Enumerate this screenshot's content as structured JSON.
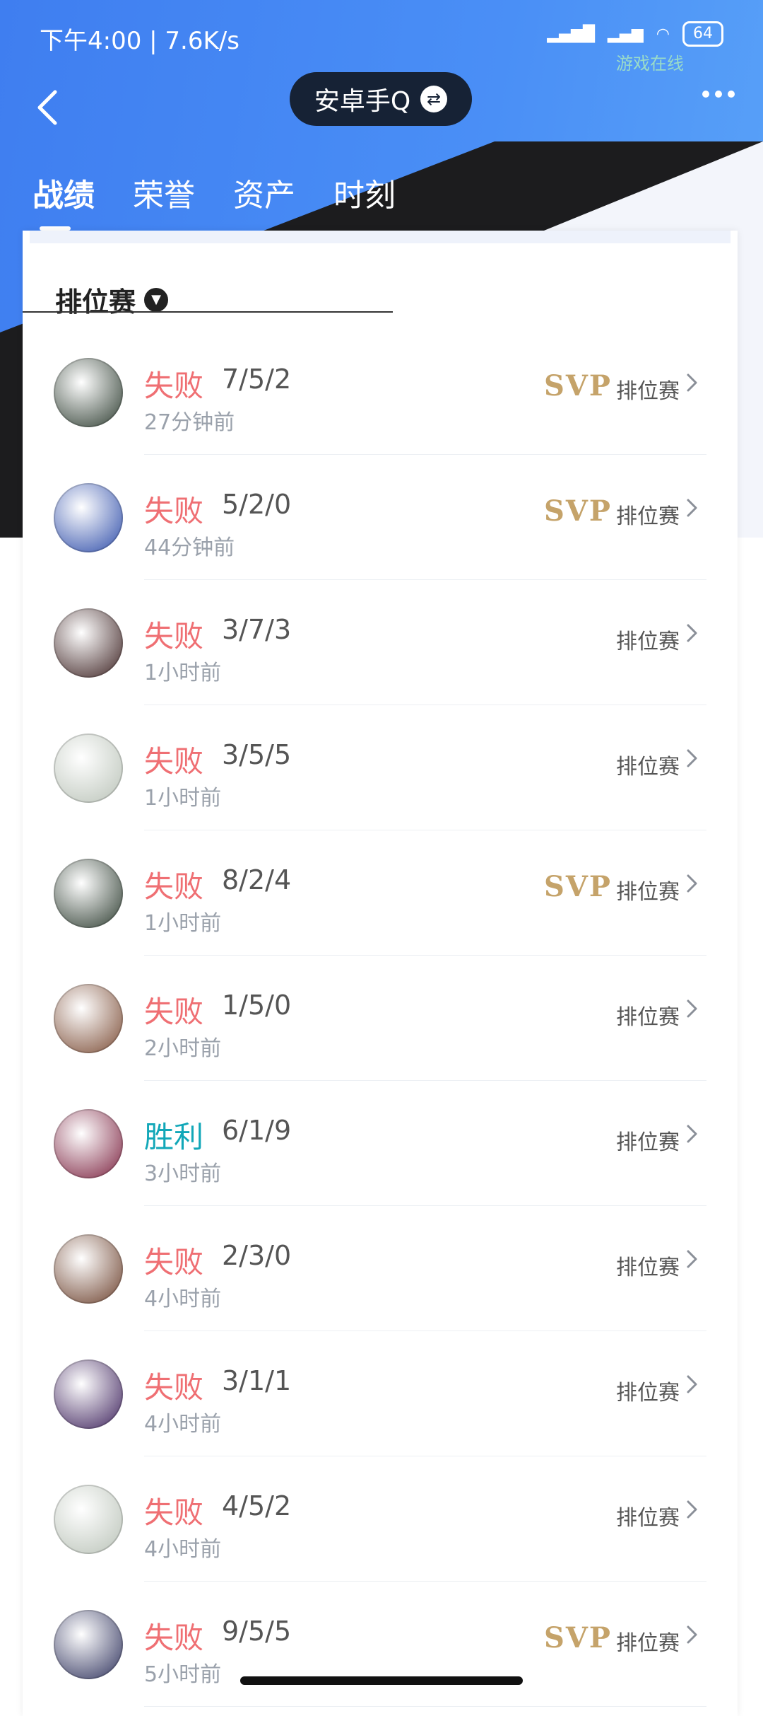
{
  "status_bar": {
    "time": "下午4:00 | 7.6K/s",
    "battery": "64",
    "game_online": "游戏在线"
  },
  "nav": {
    "account_name": "安卓手Q",
    "back_icon": "chevron-left-icon",
    "switch_icon": "switch-icon",
    "more_icon": "more-dots-icon"
  },
  "tabs": [
    "战绩",
    "荣誉",
    "资产",
    "时刻"
  ],
  "filter": {
    "label": "排位赛"
  },
  "matches": [
    {
      "result": "失败",
      "kda": "7/5/2",
      "time": "27分钟前",
      "svp": "SVP",
      "mode": "排位赛",
      "avatar_color": "#2b3a2e"
    },
    {
      "result": "失败",
      "kda": "5/2/0",
      "time": "44分钟前",
      "svp": "SVP",
      "mode": "排位赛",
      "avatar_color": "#2b4aa8"
    },
    {
      "result": "失败",
      "kda": "3/7/3",
      "time": "1小时前",
      "svp": "",
      "mode": "排位赛",
      "avatar_color": "#3a1f1f"
    },
    {
      "result": "失败",
      "kda": "3/5/5",
      "time": "1小时前",
      "svp": "",
      "mode": "排位赛",
      "avatar_color": "#b9c2b7"
    },
    {
      "result": "失败",
      "kda": "8/2/4",
      "time": "1小时前",
      "svp": "SVP",
      "mode": "排位赛",
      "avatar_color": "#2b3a2e"
    },
    {
      "result": "失败",
      "kda": "1/5/0",
      "time": "2小时前",
      "svp": "",
      "mode": "排位赛",
      "avatar_color": "#7a4a33"
    },
    {
      "result": "胜利",
      "kda": "6/1/9",
      "time": "3小时前",
      "svp": "",
      "mode": "排位赛",
      "avatar_color": "#7a1f3d"
    },
    {
      "result": "失败",
      "kda": "2/3/0",
      "time": "4小时前",
      "svp": "",
      "mode": "排位赛",
      "avatar_color": "#6b3f2b"
    },
    {
      "result": "失败",
      "kda": "3/1/1",
      "time": "4小时前",
      "svp": "",
      "mode": "排位赛",
      "avatar_color": "#3b1f5a"
    },
    {
      "result": "失败",
      "kda": "4/5/2",
      "time": "4小时前",
      "svp": "",
      "mode": "排位赛",
      "avatar_color": "#b9c2b7"
    },
    {
      "result": "失败",
      "kda": "9/5/5",
      "time": "5小时前",
      "svp": "SVP",
      "mode": "排位赛",
      "avatar_color": "#2c2f5a"
    }
  ],
  "colors": {
    "lose": "#ef6f73",
    "win": "#11a7b8",
    "svp": "#c5a36a"
  }
}
